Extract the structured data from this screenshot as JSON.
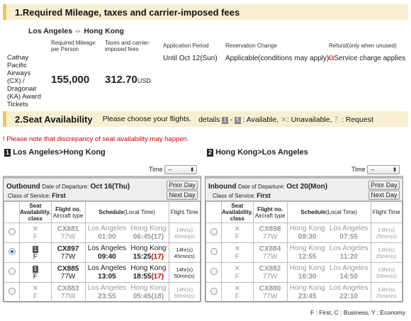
{
  "section1": {
    "number": "1.",
    "title": "Required Mileage, taxes and carrier-imposed fees"
  },
  "route": {
    "from": "Los Angeles",
    "arrow": "⇔",
    "to": "Hong Kong"
  },
  "cols": {
    "mileage": "Required Mileage per Person",
    "taxes": "Taxes and carrier-imposed fees",
    "application": "Application Period",
    "reservation": "Reservation Change",
    "refund": "Refund(only when unused)"
  },
  "award": {
    "name": "Cathay Pacific Airways (CX) / Dragonair (KA) Award Tickets",
    "mileage": "155,000",
    "taxes": "312.70",
    "currency": "USD",
    "application": "Until Oct 12(Sun)",
    "reservation_prefix": "Applicable",
    "reservation_link": "(conditions may apply)",
    "refund": "Service charge applies"
  },
  "section2": {
    "title": "2.Seat Availability",
    "prompt": "Please choose your flights.",
    "details_label": "details",
    "range_a": "1",
    "range_b": "5",
    "available": ": Available,",
    "unavailable_symbol": "✕",
    "unavailable": ": Unavailable,",
    "request_symbol": "？",
    "request": ": Request"
  },
  "warning": "! Please note that discrepancy of seat availability may happen.",
  "leg1": {
    "num": "1",
    "title": "Los Angeles>Hong Kong",
    "time_label": "Time",
    "time_value": "–",
    "dir": "Outbound",
    "date_label": "Date of Departure:",
    "date": "Oct 16(Thu)",
    "class_label": "Class of Service:",
    "class": "First",
    "prior": "Prior Day",
    "next": "Next Day"
  },
  "leg2": {
    "num": "2",
    "title": "Hong Kong>Los Angeles",
    "time_label": "Time",
    "time_value": "–",
    "dir": "Inbound",
    "date_label": "Date of Departure:",
    "date": "Oct 20(Mon)",
    "class_label": "Class of Service:",
    "class": "First",
    "prior": "Prior Day",
    "next": "Next Day"
  },
  "headers": {
    "seat": "Seat Availability. class",
    "flight": "Flight no.",
    "aircraft": "Aircraft type",
    "schedule": "Schedule",
    "local": "(Local Time)",
    "ftime": "Flight Time"
  },
  "outbound": [
    {
      "avail": "✕",
      "cls": "F",
      "flight": "CX881",
      "ac": "77W",
      "from": "Los Angeles",
      "dep": "01:00",
      "to": "Hong Kong",
      "arr": "06:45",
      "plus": "(17)",
      "ft1": "14hr(s)",
      "ft2": "45min(s)"
    },
    {
      "avail": "1",
      "cls": "F",
      "flight": "CX897",
      "ac": "77W",
      "from": "Los Angeles",
      "dep": "09:40",
      "to": "Hong Kong",
      "arr": "15:25",
      "plus": "(17)",
      "ft1": "14hr(s)",
      "ft2": "45min(s)"
    },
    {
      "avail": "1",
      "cls": "F",
      "flight": "CX885",
      "ac": "77W",
      "from": "Los Angeles",
      "dep": "13:05",
      "to": "Hong Kong",
      "arr": "18:55",
      "plus": "(17)",
      "ft1": "14hr(s)",
      "ft2": "50min(s)"
    },
    {
      "avail": "✕",
      "cls": "F",
      "flight": "CX883",
      "ac": "77W",
      "from": "Los Angeles",
      "dep": "23:55",
      "to": "Hong Kong",
      "arr": "05:45",
      "plus": "(18)",
      "ft1": "14hr(s)",
      "ft2": "50min(s)"
    }
  ],
  "inbound": [
    {
      "avail": "✕",
      "cls": "F",
      "flight": "CX898",
      "ac": "77W",
      "from": "Hong Kong",
      "dep": "09:30",
      "to": "Los Angeles",
      "arr": "07:55",
      "ft1": "13hr(s)",
      "ft2": "25min(s)"
    },
    {
      "avail": "✕",
      "cls": "F",
      "flight": "CX884",
      "ac": "77W",
      "from": "Hong Kong",
      "dep": "12:55",
      "to": "Los Angeles",
      "arr": "11:20",
      "ft1": "13hr(s)",
      "ft2": "25min(s)"
    },
    {
      "avail": "✕",
      "cls": "F",
      "flight": "CX882",
      "ac": "77W",
      "from": "Hong Kong",
      "dep": "16:30",
      "to": "Los Angeles",
      "arr": "14:50",
      "ft1": "13hr(s)",
      "ft2": "20min(s)"
    },
    {
      "avail": "✕",
      "cls": "F",
      "flight": "CX880",
      "ac": "77W",
      "from": "Hong Kong",
      "dep": "23:45",
      "to": "Los Angeles",
      "arr": "22:10",
      "ft1": "13hr(s)",
      "ft2": "25min(s)"
    }
  ],
  "selected_outbound": 1,
  "footer": "F : First, C : Business, Y : Economy",
  "colors": {
    "header_bg": "#f8efd2",
    "accent": "#e8c860",
    "warning": "#cc0000"
  }
}
